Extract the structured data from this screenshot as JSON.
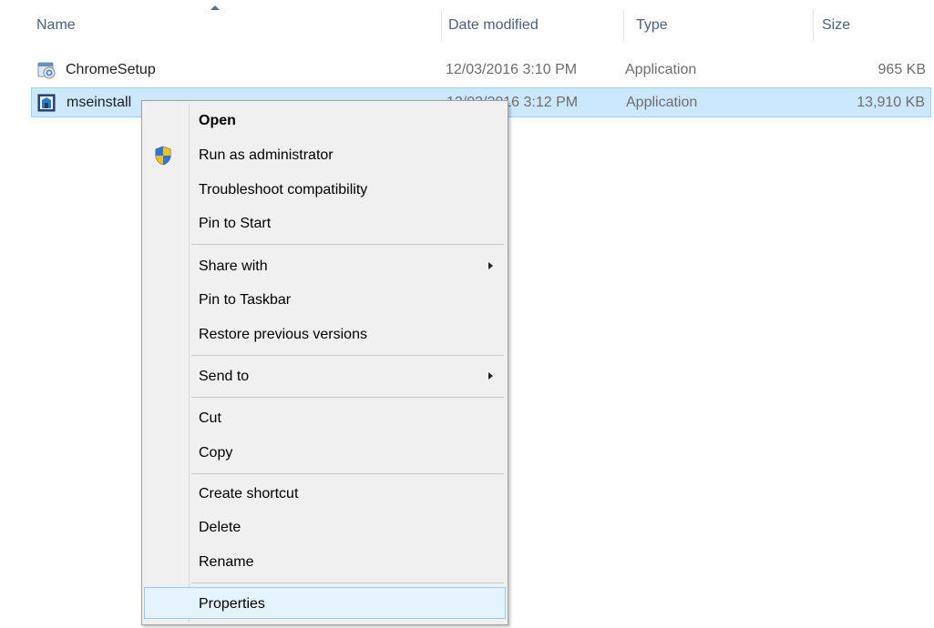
{
  "columns": {
    "name": "Name",
    "date_modified": "Date modified",
    "type": "Type",
    "size": "Size"
  },
  "files": [
    {
      "name": "ChromeSetup",
      "date": "12/03/2016 3:10 PM",
      "type": "Application",
      "size": "965 KB",
      "icon": "chrome-setup-icon",
      "selected": false
    },
    {
      "name": "mseinstall",
      "date": "12/03/2016 3:12 PM",
      "type": "Application",
      "size": "13,910 KB",
      "icon": "mse-installer-icon",
      "selected": true
    }
  ],
  "context_menu": {
    "items": [
      {
        "label": "Open",
        "bold": true
      },
      {
        "label": "Run as administrator",
        "icon": "uac-shield-icon"
      },
      {
        "label": "Troubleshoot compatibility"
      },
      {
        "label": "Pin to Start"
      },
      {
        "label": "Share with",
        "submenu": true
      },
      {
        "label": "Pin to Taskbar"
      },
      {
        "label": "Restore previous versions"
      },
      {
        "label": "Send to",
        "submenu": true
      },
      {
        "label": "Cut"
      },
      {
        "label": "Copy"
      },
      {
        "label": "Create shortcut"
      },
      {
        "label": "Delete"
      },
      {
        "label": "Rename"
      },
      {
        "label": "Properties",
        "hovered": true
      }
    ]
  },
  "colors": {
    "selection_bg": "#cce8ff",
    "selection_border": "#99d1ff",
    "menu_bg": "#f0f0f0",
    "header_text": "#4c607a"
  }
}
